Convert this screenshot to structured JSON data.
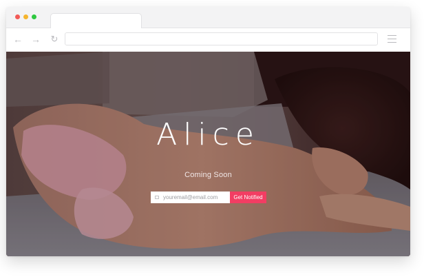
{
  "browser": {
    "tab_title": "",
    "address": "",
    "icons": {
      "back": "arrow-left-icon",
      "forward": "arrow-right-icon",
      "reload": "reload-icon",
      "menu": "hamburger-menu-icon"
    },
    "traffic_lights": [
      "#f25a57",
      "#f5b52e",
      "#2ec840"
    ]
  },
  "page": {
    "brand": "Alice",
    "tagline": "Coming Soon",
    "email_placeholder": "youremail@email.com",
    "email_value": "",
    "button_label": "Get Notified",
    "accent_color": "#f23d63",
    "mail_icon": "envelope-icon"
  }
}
